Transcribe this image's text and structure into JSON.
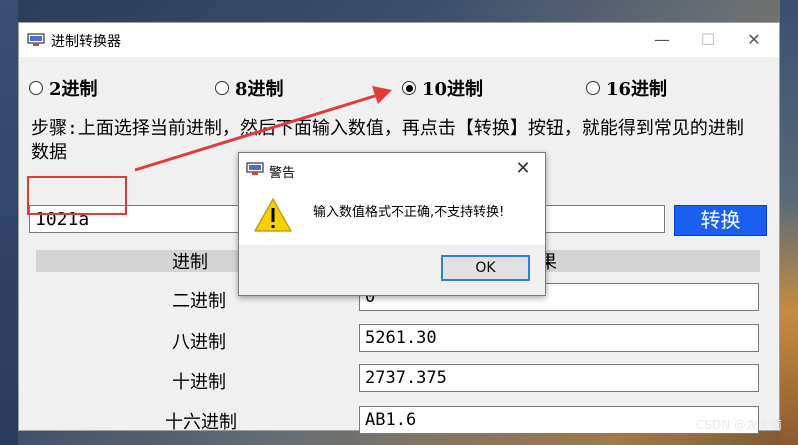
{
  "window": {
    "title": "进制转换器",
    "minimize": "—",
    "maximize": "☐",
    "close": "✕"
  },
  "radios": [
    {
      "label": "2进制",
      "checked": false
    },
    {
      "label": "8进制",
      "checked": false
    },
    {
      "label": "10进制",
      "checked": true
    },
    {
      "label": "16进制",
      "checked": false
    }
  ],
  "steps_text": "步骤:上面选择当前进制，然后下面输入数值，再点击【转换】按钮，就能得到常见的进制数据",
  "input": {
    "value": "1021a"
  },
  "convert_button": "转换",
  "table": {
    "header_base": "进制",
    "header_result": "结果",
    "rows": [
      {
        "label": "二进制",
        "value": "0"
      },
      {
        "label": "八进制",
        "value": "5261.30"
      },
      {
        "label": "十进制",
        "value": "2737.375"
      },
      {
        "label": "十六进制",
        "value": "AB1.6"
      }
    ]
  },
  "dialog": {
    "title": "警告",
    "close": "✕",
    "message": "输入数值格式不正确,不支持转换!",
    "ok": "OK"
  },
  "watermark": "CSDN @龙木南",
  "colors": {
    "accent": "#1a5ff0",
    "annotation_red": "#e03a3a",
    "warning_yellow": "#f6d000"
  }
}
